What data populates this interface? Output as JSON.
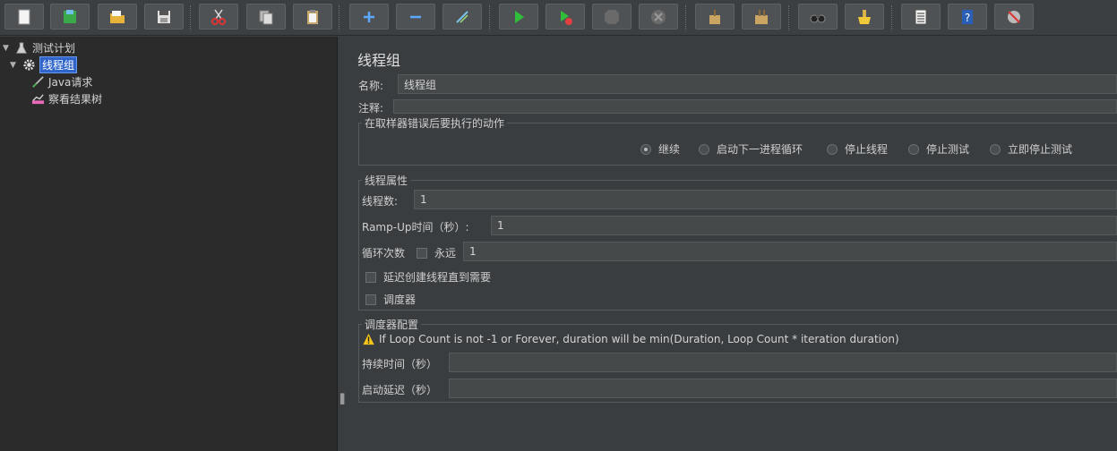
{
  "toolbar": {
    "buttons": [
      {
        "name": "new",
        "icon": "new-file-icon"
      },
      {
        "name": "templates",
        "icon": "templates-icon"
      },
      {
        "name": "open",
        "icon": "open-folder-icon"
      },
      {
        "name": "save",
        "icon": "save-icon"
      },
      {
        "name": "cut",
        "icon": "cut-icon"
      },
      {
        "name": "copy",
        "icon": "copy-icon"
      },
      {
        "name": "paste",
        "icon": "paste-icon"
      },
      {
        "name": "expand",
        "icon": "plus-icon"
      },
      {
        "name": "collapse",
        "icon": "minus-icon"
      },
      {
        "name": "toggle",
        "icon": "toggle-icon"
      },
      {
        "name": "start",
        "icon": "start-icon"
      },
      {
        "name": "start-no-pause",
        "icon": "start-no-timers-icon"
      },
      {
        "name": "stop",
        "icon": "stop-icon"
      },
      {
        "name": "shutdown",
        "icon": "shutdown-icon"
      },
      {
        "name": "clear",
        "icon": "broom-clear-icon"
      },
      {
        "name": "clear-all",
        "icon": "broom-clear-all-icon"
      },
      {
        "name": "search",
        "icon": "binoculars-icon"
      },
      {
        "name": "reset-search",
        "icon": "reset-search-icon"
      },
      {
        "name": "function-helper",
        "icon": "list-icon"
      },
      {
        "name": "help",
        "icon": "help-icon"
      },
      {
        "name": "remote",
        "icon": "remote-icon"
      }
    ]
  },
  "tree": {
    "items": [
      {
        "label": "测试计划",
        "icon": "test-plan-icon",
        "expanded": true
      },
      {
        "label": "线程组",
        "icon": "gear-icon",
        "expanded": true,
        "selected": true
      },
      {
        "label": "Java请求",
        "icon": "java-sampler-icon"
      },
      {
        "label": "察看结果树",
        "icon": "results-tree-icon"
      }
    ]
  },
  "editor": {
    "title": "线程组",
    "name_label": "名称:",
    "name_value": "线程组",
    "comment_label": "注释:",
    "comment_value": "",
    "error_action": {
      "title": "在取样器错误后要执行的动作",
      "options": [
        {
          "label": "继续",
          "selected": true
        },
        {
          "label": "启动下一进程循环",
          "selected": false
        },
        {
          "label": "停止线程",
          "selected": false
        },
        {
          "label": "停止测试",
          "selected": false
        },
        {
          "label": "立即停止测试",
          "selected": false
        }
      ]
    },
    "thread_props": {
      "title": "线程属性",
      "num_threads_label": "线程数:",
      "num_threads_value": "1",
      "rampup_label": "Ramp-Up时间（秒）:",
      "rampup_value": "1",
      "loop_label": "循环次数",
      "forever_label": "永远",
      "forever_checked": false,
      "loop_value": "1",
      "delay_label": "延迟创建线程直到需要",
      "delay_checked": false,
      "scheduler_label": "调度器",
      "scheduler_checked": false
    },
    "scheduler_config": {
      "title": "调度器配置",
      "warning": "If Loop Count is not -1 or Forever, duration will be min(Duration, Loop Count * iteration duration)",
      "duration_label": "持续时间（秒）",
      "duration_value": "",
      "delay_label": "启动延迟（秒）",
      "delay_value": ""
    }
  },
  "colors": {
    "accent": "#2f65ca",
    "background": "#3a3d3f",
    "tree_background": "#2b2b2b"
  }
}
